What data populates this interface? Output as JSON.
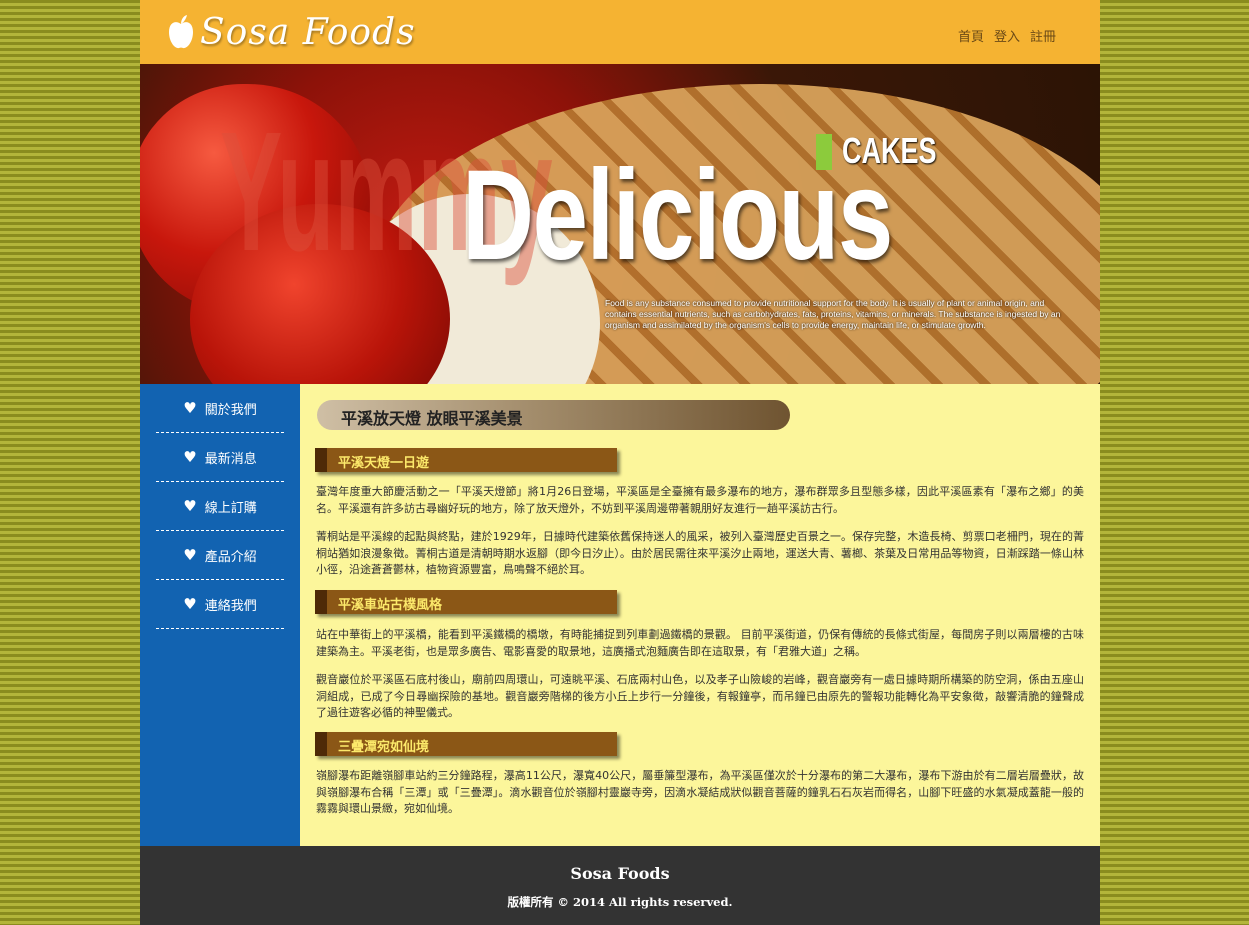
{
  "header": {
    "logo_text": "Sosa Foods",
    "nav": [
      "首頁",
      "登入",
      "註冊"
    ]
  },
  "banner": {
    "bg_word": "Yummy",
    "tag": "CAKES",
    "headline": "Delicious",
    "description": "Food is any substance consumed to provide nutritional support for the body. It is usually of plant or animal origin, and contains essential nutrients, such as carbohydrates, fats, proteins, vitamins, or minerals. The substance is ingested by an organism and assimilated by the organism's cells to provide energy, maintain life, or stimulate growth."
  },
  "sidebar": {
    "items": [
      {
        "label": "關於我們"
      },
      {
        "label": "最新消息"
      },
      {
        "label": "線上訂購"
      },
      {
        "label": "產品介紹"
      },
      {
        "label": "連絡我們"
      }
    ]
  },
  "content": {
    "page_title": "平溪放天燈 放眼平溪美景",
    "sections": [
      {
        "heading": "平溪天燈一日遊",
        "paragraphs": [
          "臺灣年度重大節慶活動之一「平溪天燈節」將1月26日登場，平溪區是全臺擁有最多瀑布的地方，瀑布群眾多且型態多樣，因此平溪區素有「瀑布之鄉」的美名。平溪還有許多訪古尋幽好玩的地方，除了放天燈外，不妨到平溪周邊帶著親朋好友進行一趟平溪訪古行。",
          "菁桐站是平溪線的起點與終點，建於1929年，日據時代建築依舊保持迷人的風采，被列入臺灣歷史百景之一。保存完整，木造長椅、剪票口老柵門，現在的菁桐站猶如浪漫象徵。菁桐古道是清朝時期水返腳（即今日汐止）。由於居民需往來平溪汐止兩地，運送大青、薯榔、茶葉及日常用品等物資，日漸踩踏一條山林小徑，沿途蒼蒼鬱林，植物資源豐富，鳥鳴聲不絕於耳。"
        ]
      },
      {
        "heading": "平溪車站古樸風格",
        "paragraphs": [
          "站在中華街上的平溪橋，能看到平溪鐵橋的橋墩，有時能捕捉到列車劃過鐵橋的景觀。 目前平溪街道，仍保有傳統的長條式街屋，每間房子則以兩層樓的古味建築為主。平溪老街，也是眾多廣告、電影喜愛的取景地，這廣播式泡麵廣告即在這取景，有「君雅大道」之稱。",
          "觀音巖位於平溪區石底村後山，廟前四周環山，可遠眺平溪、石底兩村山色，以及孝子山險峻的岩峰，觀音巖旁有一處日據時期所構築的防空洞，係由五座山洞組成，已成了今日尋幽探險的基地。觀音巖旁階梯的後方小丘上步行一分鐘後，有報鐘亭，而吊鐘已由原先的警報功能轉化為平安象徵，敲響清脆的鐘聲成了過往遊客必循的神聖儀式。"
        ]
      },
      {
        "heading": "三疊潭宛如仙境",
        "paragraphs": [
          "嶺腳瀑布距離嶺腳車站約三分鐘路程，瀑高11公尺，瀑寬40公尺，屬垂簾型瀑布，為平溪區僅次於十分瀑布的第二大瀑布，瀑布下游由於有二層岩層疊狀，故與嶺腳瀑布合稱「三潭」或「三疊潭」。滴水觀音位於嶺腳村靈巖寺旁，因滴水凝結成狀似觀音菩薩的鐘乳石石灰岩而得名，山腳下旺盛的水氣凝成蓋龍一般的霧霧與環山景緻，宛如仙境。"
        ]
      }
    ]
  },
  "footer": {
    "title": "Sosa Foods",
    "copyright": "版權所有 © 2014 All rights reserved."
  }
}
